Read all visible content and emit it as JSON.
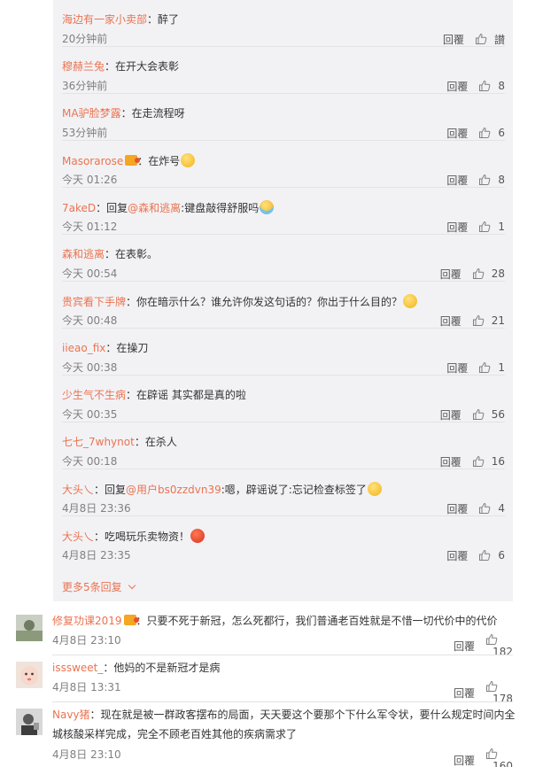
{
  "colors": {
    "username": "#eb7350",
    "panel": "#f2f2f5",
    "muted": "#808080"
  },
  "replies": [
    {
      "user": "海边有一家小卖部",
      "badge": false,
      "prefix": "",
      "target": "",
      "text": "：醉了",
      "emoji": "",
      "time": "20分钟前",
      "reply_label": "回覆",
      "likes": "讃"
    },
    {
      "user": "穆赫兰兔",
      "badge": false,
      "prefix": "",
      "target": "",
      "text": "：在开大会表彰",
      "emoji": "",
      "time": "36分钟前",
      "reply_label": "回覆",
      "likes": "8"
    },
    {
      "user": "MA驴脸梦露",
      "badge": false,
      "prefix": "",
      "target": "",
      "text": "：在走流程呀",
      "emoji": "",
      "time": "53分钟前",
      "reply_label": "回覆",
      "likes": "6"
    },
    {
      "user": "Masorarose",
      "badge": true,
      "prefix": "",
      "target": "",
      "text": "：在炸号",
      "emoji": "yellow",
      "time": "今天 01:26",
      "reply_label": "回覆",
      "likes": "8"
    },
    {
      "user": "7akeD",
      "badge": false,
      "prefix": "：回复",
      "target": "@森和逃离",
      "text": ":键盘敲得舒服吗",
      "emoji": "cry",
      "time": "今天 01:12",
      "reply_label": "回覆",
      "likes": "1"
    },
    {
      "user": "森和逃离",
      "badge": false,
      "prefix": "",
      "target": "",
      "text": "：在表彰。",
      "emoji": "",
      "time": "今天 00:54",
      "reply_label": "回覆",
      "likes": "28"
    },
    {
      "user": "贵宾看下手牌",
      "badge": false,
      "prefix": "",
      "target": "",
      "text": "：你在暗示什么？谁允许你发这句话的？你出于什么目的？",
      "emoji": "yellow",
      "time": "今天 00:48",
      "reply_label": "回覆",
      "likes": "21"
    },
    {
      "user": "iieao_fix",
      "badge": false,
      "prefix": "",
      "target": "",
      "text": "：在操刀",
      "emoji": "",
      "time": "今天 00:38",
      "reply_label": "回覆",
      "likes": "1"
    },
    {
      "user": "少生气不生病",
      "badge": false,
      "prefix": "",
      "target": "",
      "text": "：在辟谣 其实都是真的啦",
      "emoji": "",
      "time": "今天 00:35",
      "reply_label": "回覆",
      "likes": "56"
    },
    {
      "user": "七七_7whynot",
      "badge": false,
      "prefix": "",
      "target": "",
      "text": "：在杀人",
      "emoji": "",
      "time": "今天 00:18",
      "reply_label": "回覆",
      "likes": "16"
    },
    {
      "user": "大头乀",
      "badge": false,
      "prefix": "：回复",
      "target": "@用户bs0zzdvn39",
      "text": ":嗯，辟谣说了:忘记检查标签了",
      "emoji": "yellow",
      "time": "4月8日 23:36",
      "reply_label": "回覆",
      "likes": "4"
    },
    {
      "user": "大头乀",
      "badge": false,
      "prefix": "",
      "target": "",
      "text": "：吃喝玩乐卖物资！",
      "emoji": "red",
      "time": "4月8日 23:35",
      "reply_label": "回覆",
      "likes": "6"
    }
  ],
  "more_replies": "更多5条回复",
  "comments": [
    {
      "user": "修复功课2019",
      "badge": true,
      "lines": [
        "：只要不死于新冠，怎么死都行，我们普通老百姓就是不惜一切代价中的代价"
      ],
      "time": "4月8日 23:10",
      "reply_label": "回覆",
      "likes": "182"
    },
    {
      "user": "isssweet_",
      "badge": false,
      "lines": [
        "：他妈的不是新冠才是病"
      ],
      "time": "4月8日 13:31",
      "reply_label": "回覆",
      "likes": "178"
    },
    {
      "user": "Navy猪",
      "badge": false,
      "lines": [
        "：现在就是被一群政客摆布的局面，天天要这个要那个下什么军令状，要什么规定时间内全",
        "城核酸采样完成，完全不顾老百姓其他的疾病需求了"
      ],
      "time": "4月8日 23:10",
      "reply_label": "回覆",
      "likes": "160"
    }
  ]
}
